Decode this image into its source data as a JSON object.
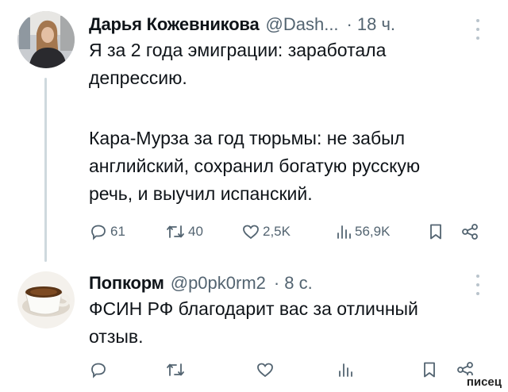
{
  "tweet1": {
    "author_name": "Дарья Кожевникова",
    "handle": "@Dash...",
    "separator": "·",
    "time": "18 ч.",
    "line1": "Я за 2 года эмиграции: заработала",
    "line2": "депрессию.",
    "line3": "Кара-Мурза за год тюрьмы: не забыл",
    "line4": "английский, сохранил богатую русскую",
    "line5": "речь, и выучил испанский.",
    "replies": "61",
    "reposts": "40",
    "likes": "2,5K",
    "views": "56,9K",
    "icons": [
      "avatar",
      "more-icon",
      "reply-icon",
      "repost-icon",
      "like-icon",
      "views-icon",
      "bookmark-icon",
      "share-icon"
    ]
  },
  "tweet2": {
    "author_name": "Попкорм",
    "handle": "@p0pk0rm2",
    "separator": "·",
    "time": "8 с.",
    "line1": "ФСИН РФ благодарит вас за отличный",
    "line2": "отзыв.",
    "icons": [
      "avatar",
      "more-icon",
      "reply-icon",
      "repost-icon",
      "like-icon",
      "views-icon",
      "bookmark-icon",
      "share-icon"
    ]
  },
  "watermark": "писец",
  "colors": {
    "text": "#0f1419",
    "muted": "#536471",
    "thread_line": "#cfd9de"
  }
}
